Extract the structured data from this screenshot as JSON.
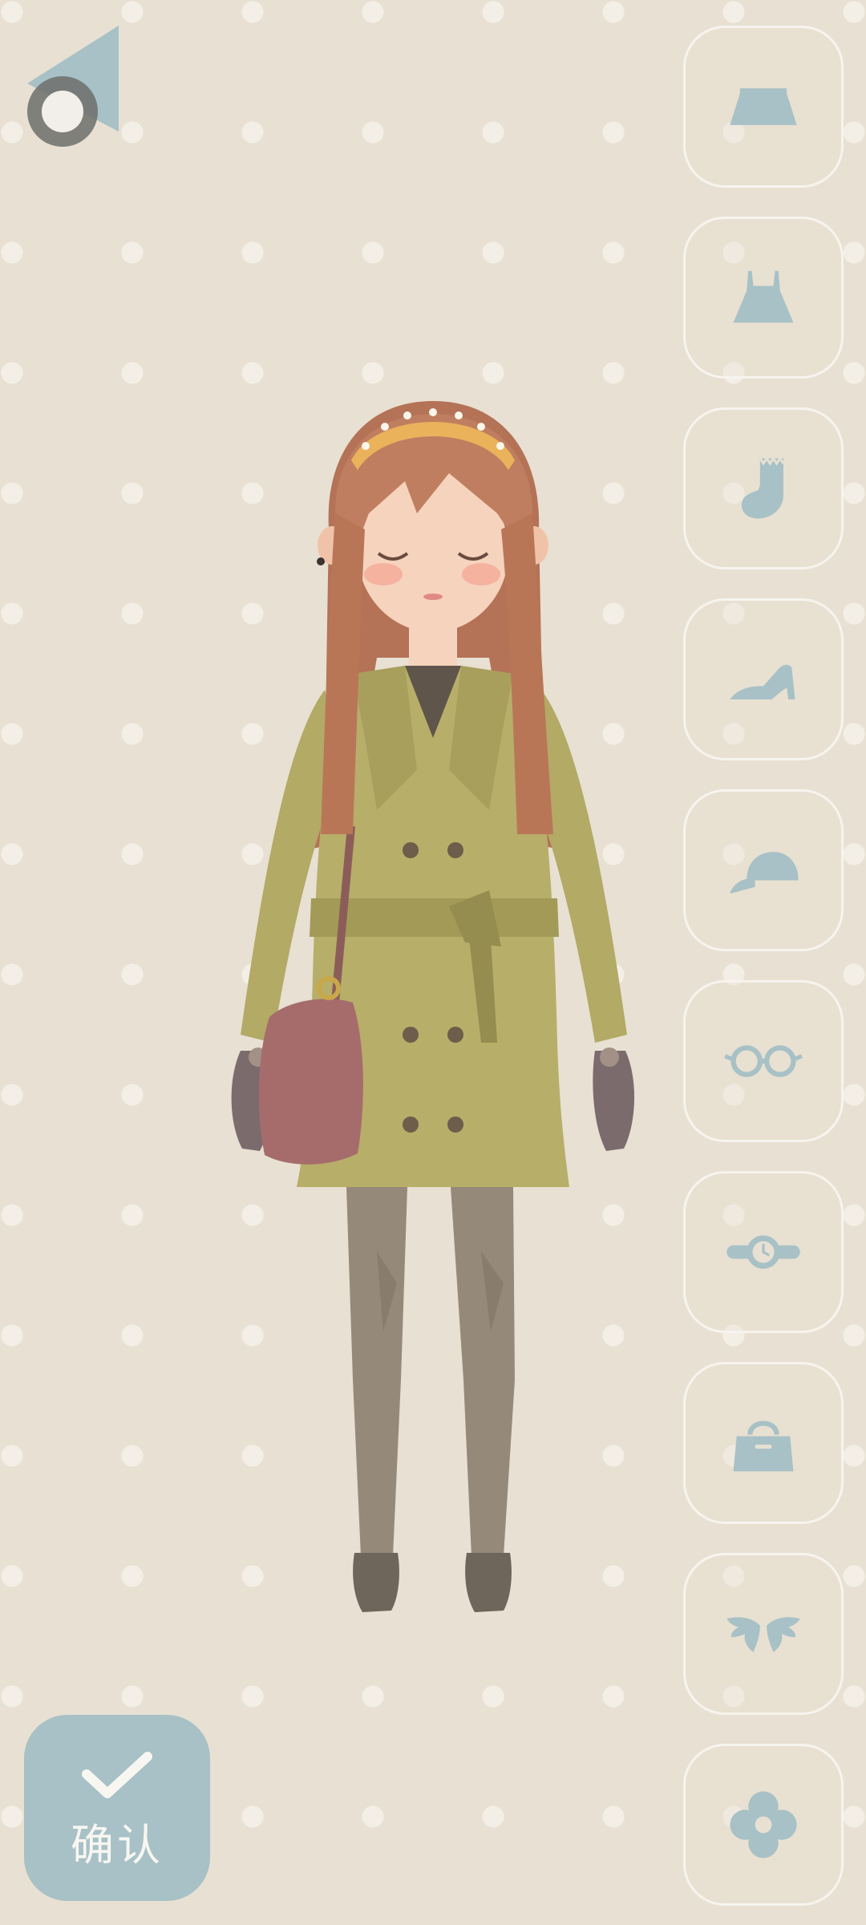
{
  "confirm": {
    "label": "确认",
    "icon": "check-icon"
  },
  "back": {
    "icon": "back-arrow-icon"
  },
  "categories": [
    {
      "id": "skirt",
      "icon": "skirt-icon"
    },
    {
      "id": "dress",
      "icon": "dress-icon"
    },
    {
      "id": "socks",
      "icon": "sock-icon"
    },
    {
      "id": "shoes",
      "icon": "heel-shoe-icon"
    },
    {
      "id": "hat",
      "icon": "cap-icon"
    },
    {
      "id": "glasses",
      "icon": "glasses-icon"
    },
    {
      "id": "watch",
      "icon": "watch-icon"
    },
    {
      "id": "bag",
      "icon": "handbag-icon"
    },
    {
      "id": "wings",
      "icon": "wings-icon"
    },
    {
      "id": "flower",
      "icon": "flower-icon"
    }
  ],
  "colors": {
    "background": "#e8e0d2",
    "dots": "#f4efe6",
    "accent": "#a7c1c6",
    "button_border": "#f7f4ee",
    "confirm_text": "#f8f6f1"
  }
}
